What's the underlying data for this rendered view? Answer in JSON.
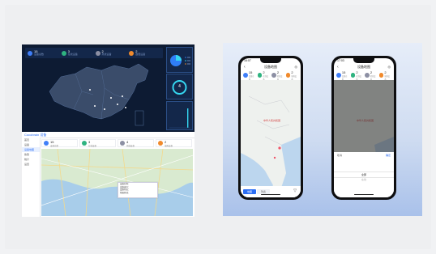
{
  "left_dashboard": {
    "top_stats": [
      {
        "value": "15",
        "label": "设备总数",
        "color": "#3f7ef8"
      },
      {
        "value": "3",
        "label": "在线设备",
        "color": "#2fb380"
      },
      {
        "value": "2",
        "label": "离线设备",
        "color": "#8c8fa3"
      },
      {
        "value": "2",
        "label": "故障设备",
        "color": "#f08a2c"
      }
    ],
    "donut_center": "4",
    "accent": "#35d6f0"
  },
  "left_admin": {
    "brand": "Cocobrain 设备",
    "sidebar_items": [
      "首页",
      "设备",
      "设备地图",
      "告警",
      "统计",
      "设置"
    ],
    "stats": [
      {
        "value": "15",
        "label": "设备总数",
        "color": "#3f7ef8"
      },
      {
        "value": "3",
        "label": "在线设备",
        "color": "#2fb380"
      },
      {
        "value": "4",
        "label": "离线设备",
        "color": "#8c8fa3"
      },
      {
        "value": "2",
        "label": "故障设备",
        "color": "#f08a2c"
      }
    ],
    "popup_lines": [
      "设备名称：",
      "设备编号：",
      "设备状态：",
      "所属区域："
    ]
  },
  "phone1": {
    "time": "16:07",
    "title": "设备地图",
    "stats": [
      {
        "value": "15",
        "label": "设备总数",
        "color": "#3f7ef8"
      },
      {
        "value": "2",
        "label": "在线设备",
        "color": "#2fb380"
      },
      {
        "value": "2",
        "label": "离线设备",
        "color": "#8c8fa3"
      },
      {
        "value": "2",
        "label": "故障设备",
        "color": "#f08a2c"
      }
    ],
    "map_label": "中华人民共和国",
    "btn_map": "地图",
    "btn_list": "列表"
  },
  "phone2": {
    "time": "17:03",
    "title": "设备地图",
    "stats": [
      {
        "value": "15",
        "label": "设备总数",
        "color": "#3f7ef8"
      },
      {
        "value": "2",
        "label": "在线设备",
        "color": "#2fb380"
      },
      {
        "value": "2",
        "label": "离线设备",
        "color": "#8c8fa3"
      },
      {
        "value": "2",
        "label": "故障设备",
        "color": "#f08a2c"
      }
    ],
    "map_label": "中华人民共和国",
    "sheet_cancel": "取消",
    "sheet_ok": "确定",
    "sheet_opt1": "全部",
    "sheet_opt2": "在线"
  }
}
